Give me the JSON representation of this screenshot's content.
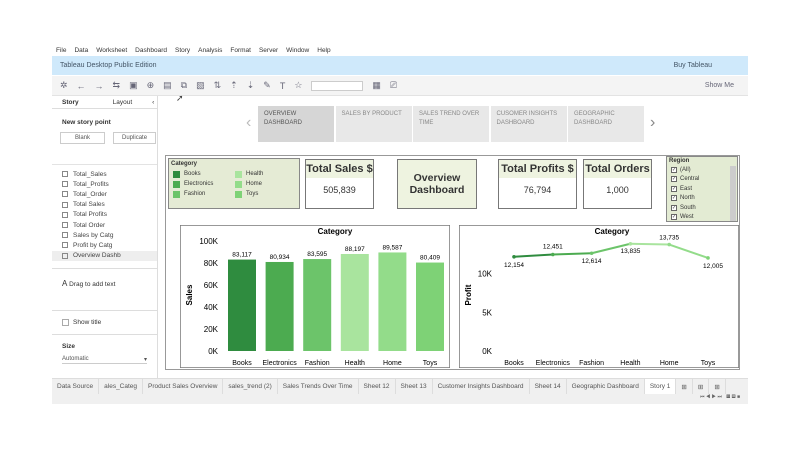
{
  "menu": [
    "File",
    "Data",
    "Worksheet",
    "Dashboard",
    "Story",
    "Analysis",
    "Format",
    "Server",
    "Window",
    "Help"
  ],
  "title": "Tableau Desktop Public Edition",
  "buy": "Buy Tableau",
  "show_me": "Show Me",
  "panel": {
    "tab_story": "Story",
    "tab_layout": "Layout",
    "new_story_point": "New story point",
    "blank": "Blank",
    "duplicate": "Duplicate",
    "sheets": [
      "Total_Sales",
      "Total_Profits",
      "Total_Order",
      "Total Sales",
      "Total Profits",
      "Total Order",
      "Sales by Catg",
      "Profit by Catg",
      "Overview Dashb"
    ],
    "drag_text": "Drag to add text",
    "show_title": "Show title",
    "size_label": "Size",
    "size_value": "Automatic"
  },
  "story_points": [
    "OVERVIEW DASHBOARD",
    "SALES BY PRODUCT",
    "SALES TREND OVER TIME",
    "CUSOMER INSIGHTS DASHBOARD",
    "GEOGRAPHIC DASHBOARD"
  ],
  "legend": {
    "title": "Category",
    "items": [
      {
        "name": "Books",
        "color": "#2f8c3f"
      },
      {
        "name": "Electronics",
        "color": "#4cab50"
      },
      {
        "name": "Fashion",
        "color": "#6cc46a"
      },
      {
        "name": "Health",
        "color": "#a9e49e"
      },
      {
        "name": "Home",
        "color": "#93dc8a"
      },
      {
        "name": "Toys",
        "color": "#7ed276"
      }
    ]
  },
  "kpis": {
    "sales_title": "Total Sales $",
    "sales_value": "505,839",
    "overview": "Overview Dashboard",
    "profit_title": "Total Profits $",
    "profit_value": "76,794",
    "orders_title": "Total Orders",
    "orders_value": "1,000"
  },
  "region": {
    "title": "Region",
    "items": [
      "(All)",
      "Central",
      "East",
      "North",
      "South",
      "West"
    ]
  },
  "chart_data": [
    {
      "type": "bar",
      "title": "Category",
      "ylabel": "Sales",
      "categories": [
        "Books",
        "Electronics",
        "Fashion",
        "Health",
        "Home",
        "Toys"
      ],
      "values": [
        83117,
        80934,
        83595,
        88197,
        89587,
        80409
      ],
      "labels": [
        "83,117",
        "80,934",
        "83,595",
        "88,197",
        "89,587",
        "80,409"
      ],
      "ylim": [
        0,
        100000
      ],
      "yticks": [
        "0K",
        "20K",
        "40K",
        "60K",
        "80K",
        "100K"
      ]
    },
    {
      "type": "line",
      "title": "Category",
      "ylabel": "Profit",
      "categories": [
        "Books",
        "Electronics",
        "Fashion",
        "Health",
        "Home",
        "Toys"
      ],
      "values": [
        12154,
        12451,
        12614,
        13835,
        13735,
        12005
      ],
      "labels": [
        "12,154",
        "12,451",
        "12,614",
        "13,835",
        "13,735",
        "12,005"
      ],
      "ylim": [
        0,
        14000
      ],
      "yticks": [
        "0K",
        "5K",
        "10K"
      ]
    }
  ],
  "bottom_tabs": [
    "Data Source",
    "ales_Categ",
    "Product Sales Overview",
    "sales_trend (2)",
    "Sales Trends Over Time",
    "Sheet 12",
    "Sheet 13",
    "Customer Insights Dashboard",
    "Sheet 14",
    "Geographic Dashboard",
    "Story 1"
  ]
}
